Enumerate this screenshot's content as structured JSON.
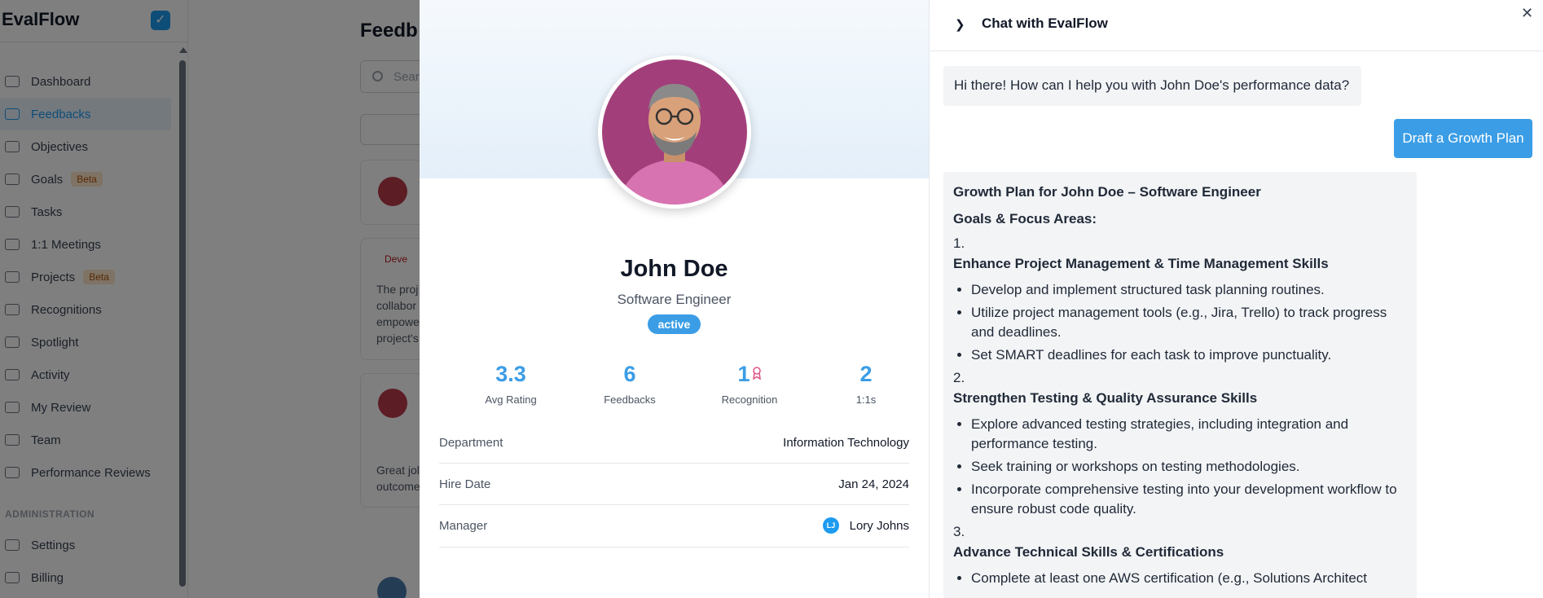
{
  "app": {
    "brand": "EvalFlow",
    "brand_badge": "✓",
    "nav_items": [
      {
        "label": "Dashboard"
      },
      {
        "label": "Feedbacks",
        "active": true
      },
      {
        "label": "Objectives"
      },
      {
        "label": "Goals",
        "badge": "Beta"
      },
      {
        "label": "Tasks"
      },
      {
        "label": "1:1 Meetings"
      },
      {
        "label": "Projects",
        "badge": "Beta"
      },
      {
        "label": "Recognitions"
      },
      {
        "label": "Spotlight"
      },
      {
        "label": "Activity"
      },
      {
        "label": "My Review"
      },
      {
        "label": "Team"
      },
      {
        "label": "Performance Reviews"
      }
    ],
    "admin_section": "ADMINISTRATION",
    "admin_items": [
      {
        "label": "Settings"
      },
      {
        "label": "Billing"
      }
    ],
    "main": {
      "title": "Feedb",
      "search_placeholder": "Sear",
      "tag": "Deve",
      "card_text_1": "The proj\ncollabor\nempowe\nproject's",
      "card_text_2": "Great jol\noutcome"
    }
  },
  "profile": {
    "name": "John Doe",
    "role": "Software Engineer",
    "status": "active",
    "stats": [
      {
        "value": "3.3",
        "label": "Avg Rating"
      },
      {
        "value": "6",
        "label": "Feedbacks"
      },
      {
        "value": "1",
        "label": "Recognition"
      },
      {
        "value": "2",
        "label": "1:1s"
      }
    ],
    "details": {
      "department": {
        "label": "Department",
        "value": "Information Technology"
      },
      "hire_date": {
        "label": "Hire Date",
        "value": "Jan 24, 2024"
      },
      "manager": {
        "label": "Manager",
        "value": "Lory Johns",
        "initials": "LJ"
      }
    }
  },
  "chat": {
    "title": "Chat with EvalFlow",
    "greeting": "Hi there! How can I help you with John Doe's performance data?",
    "user_message": "Draft a Growth Plan",
    "plan": {
      "title": "Growth Plan for John Doe – Software Engineer",
      "goals_heading": "Goals & Focus Areas:",
      "sections": [
        {
          "number": "1.",
          "title": "Enhance Project Management & Time Management Skills",
          "bullets": [
            "Develop and implement structured task planning routines.",
            "Utilize project management tools (e.g., Jira, Trello) to track progress and deadlines.",
            "Set SMART deadlines for each task to improve punctuality."
          ]
        },
        {
          "number": "2.",
          "title": "Strengthen Testing & Quality Assurance Skills",
          "bullets": [
            "Explore advanced testing strategies, including integration and performance testing.",
            "Seek training or workshops on testing methodologies.",
            "Incorporate comprehensive testing into your development workflow to ensure robust code quality."
          ]
        },
        {
          "number": "3.",
          "title": "Advance Technical Skills & Certifications",
          "bullets": [
            "Complete at least one AWS certification (e.g., Solutions Architect"
          ]
        }
      ]
    }
  },
  "colors": {
    "accent": "#3b9de6",
    "brand_blue": "#1d9bf0",
    "avatar_bg": "#a23f7a",
    "overlay": "rgba(0,0,0,0.5)"
  }
}
